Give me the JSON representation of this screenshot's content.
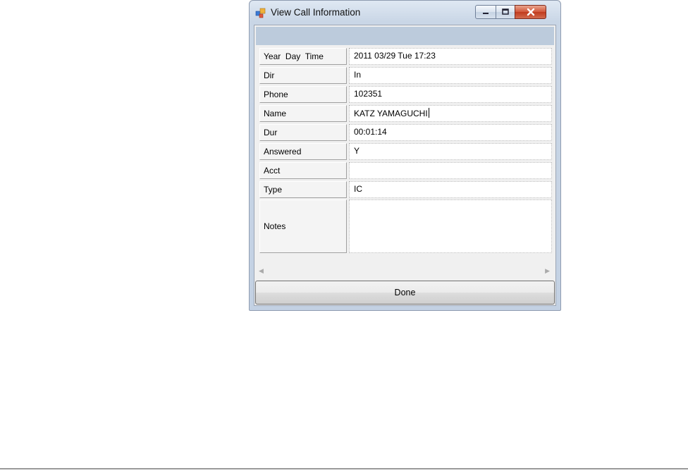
{
  "window": {
    "title": "View Call Information",
    "controls": {
      "minimize_icon": "minimize-icon",
      "maximize_icon": "maximize-icon",
      "close_icon": "close-icon"
    }
  },
  "fields": [
    {
      "label": "Year  Day  Time",
      "value": "2011 03/29 Tue 17:23"
    },
    {
      "label": "Dir",
      "value": "In"
    },
    {
      "label": "Phone",
      "value": "102351"
    },
    {
      "label": "Name",
      "value": "KATZ YAMAGUCHI"
    },
    {
      "label": "Dur",
      "value": "00:01:14"
    },
    {
      "label": "Answered",
      "value": "Y"
    },
    {
      "label": "Acct",
      "value": ""
    },
    {
      "label": "Type",
      "value": "IC"
    },
    {
      "label": "Notes",
      "value": ""
    }
  ],
  "buttons": {
    "done_label": "Done"
  },
  "colors": {
    "header_band": "#bccbdc",
    "close_button": "#c9482b",
    "titlebar": "#d0dcea"
  }
}
